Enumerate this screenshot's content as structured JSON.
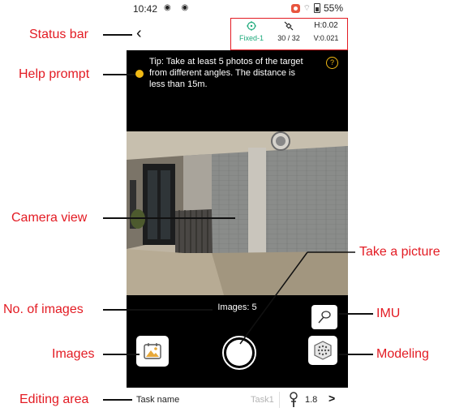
{
  "device_status": {
    "time": "10:42",
    "battery": "55%"
  },
  "gnss_status": {
    "fix_label": "Fixed-1",
    "satellites": "30 / 32",
    "h_precision": "H:0.02",
    "v_precision": "V:0.021",
    "fix_color": "#1ba97a"
  },
  "tip": {
    "text": "Tip: Take at least 5 photos of the target from different angles. The distance is less than 15m.",
    "help_label": "?"
  },
  "camera": {
    "images_label": "Images:  5"
  },
  "editing_area": {
    "task_label": "Task name",
    "task_value": "Task1",
    "pole_height": "1.8"
  },
  "callouts": {
    "status_bar": "Status bar",
    "help_prompt": "Help prompt",
    "camera_view": "Camera view",
    "take_picture": "Take a picture",
    "no_of_images": "No. of images",
    "imu": "IMU",
    "images": "Images",
    "modeling": "Modeling",
    "editing_area": "Editing area"
  },
  "colors": {
    "callout": "#e31b23",
    "tip_bullet": "#f0b915",
    "background": "#000000"
  },
  "icons": [
    "back-arrow-icon",
    "satellite-fix-icon",
    "satellite-icon",
    "help-icon",
    "imu-icon",
    "gallery-icon",
    "shutter-icon",
    "modeling-icon",
    "pole-icon",
    "chevron-right-icon"
  ]
}
